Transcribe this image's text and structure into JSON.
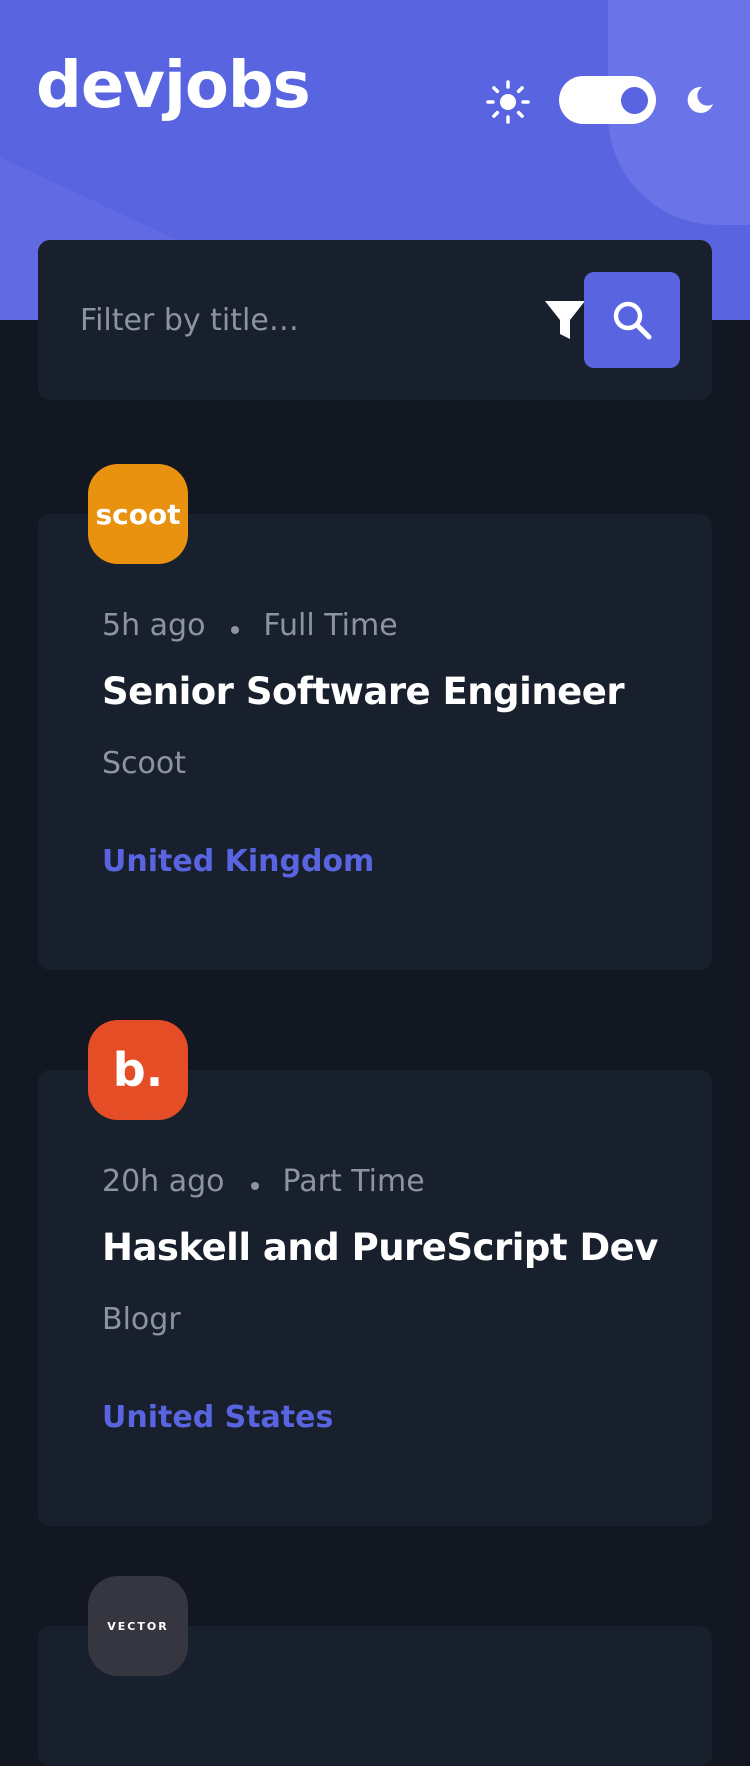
{
  "header": {
    "logo": "devjobs",
    "theme_toggle": {
      "icons": [
        "sun-icon",
        "moon-icon"
      ],
      "state": "dark"
    }
  },
  "search": {
    "placeholder": "Filter by title…",
    "filter_icon": "filter-icon",
    "search_icon": "search-icon"
  },
  "colors": {
    "accent": "#5964E0",
    "background": "#121721",
    "card": "#19202D",
    "muted_text": "#8C93A3"
  },
  "jobs": [
    {
      "logo_text": "scoot",
      "logo_color": "#E99210",
      "posted": "5h ago",
      "contract": "Full Time",
      "title": "Senior Software Engineer",
      "company": "Scoot",
      "location": "United Kingdom"
    },
    {
      "logo_text": "b.",
      "logo_color": "#E54D26",
      "posted": "20h ago",
      "contract": "Part Time",
      "title": "Haskell and PureScript Dev",
      "company": "Blogr",
      "location": "United States"
    },
    {
      "logo_text": "VECTOR",
      "logo_color": "#363640"
    }
  ]
}
